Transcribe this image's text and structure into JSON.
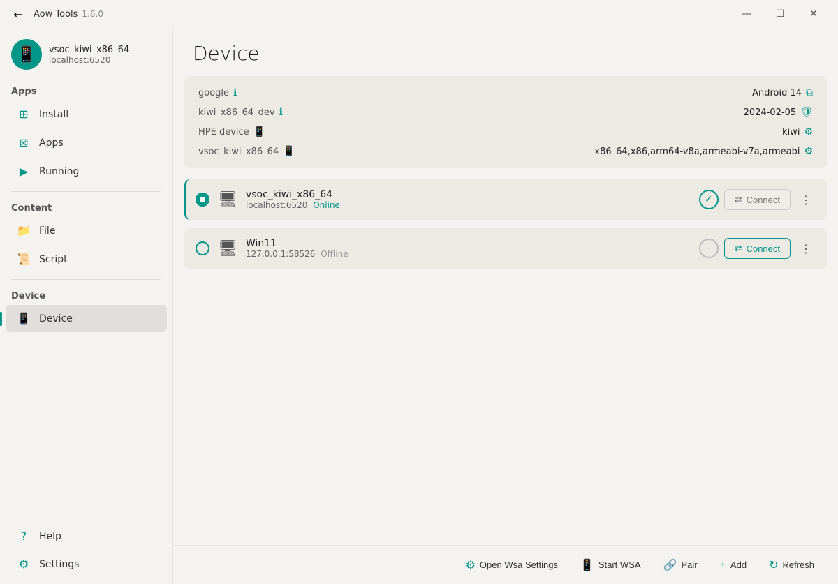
{
  "titlebar": {
    "app_name": "Aow Tools",
    "version": "1.6.0",
    "back_label": "←",
    "minimize_label": "—",
    "maximize_label": "☐",
    "close_label": "✕"
  },
  "sidebar": {
    "device_name": "vsoc_kiwi_x86_64",
    "device_host": "localhost:6520",
    "sections": [
      {
        "header": "Apps",
        "items": [
          {
            "id": "install",
            "label": "Install",
            "icon": "⊞"
          },
          {
            "id": "apps",
            "label": "Apps",
            "icon": "⊠"
          },
          {
            "id": "running",
            "label": "Running",
            "icon": "▶"
          }
        ]
      },
      {
        "header": "Content",
        "items": [
          {
            "id": "file",
            "label": "File",
            "icon": "📁"
          },
          {
            "id": "script",
            "label": "Script",
            "icon": "📜"
          }
        ]
      },
      {
        "header": "Device",
        "items": [
          {
            "id": "device",
            "label": "Device",
            "icon": "📱",
            "active": true
          }
        ]
      }
    ],
    "bottom_items": [
      {
        "id": "help",
        "label": "Help",
        "icon": "?"
      },
      {
        "id": "settings",
        "label": "Settings",
        "icon": "⚙"
      }
    ]
  },
  "page": {
    "title": "Device"
  },
  "info_panel": {
    "rows": [
      {
        "label": "google",
        "has_info": true,
        "right_label": "Android 14",
        "right_has_icon": true,
        "right_icon": "copy"
      },
      {
        "label": "kiwi_x86_64_dev",
        "has_info": true,
        "right_label": "2024-02-05",
        "right_has_icon": true,
        "right_icon": "shield"
      },
      {
        "label": "HPE device",
        "has_icon": true,
        "right_label": "kiwi",
        "right_has_icon": true,
        "right_icon": "gear"
      },
      {
        "label": "vsoc_kiwi_x86_64",
        "has_icon": true,
        "right_label": "x86_64,x86,arm64-v8a,armeabi-v7a,armeabi",
        "right_has_icon": true,
        "right_icon": "settings"
      }
    ]
  },
  "devices": [
    {
      "id": "device1",
      "name": "vsoc_kiwi_x86_64",
      "host": "localhost:6520",
      "status": "Online",
      "status_type": "online",
      "selected": true,
      "connect_label": "Connect",
      "connected": true
    },
    {
      "id": "device2",
      "name": "Win11",
      "host": "127.0.0.1:58526",
      "status": "Offline",
      "status_type": "offline",
      "selected": false,
      "connect_label": "Connect",
      "connected": false
    }
  ],
  "toolbar": {
    "buttons": [
      {
        "id": "open-wsa",
        "label": "Open Wsa Settings",
        "icon": "⚙"
      },
      {
        "id": "start-wsa",
        "label": "Start WSA",
        "icon": "📱"
      },
      {
        "id": "pair",
        "label": "Pair",
        "icon": "🔗"
      },
      {
        "id": "add",
        "label": "Add",
        "icon": "+"
      },
      {
        "id": "refresh",
        "label": "Refresh",
        "icon": "↻"
      }
    ]
  }
}
